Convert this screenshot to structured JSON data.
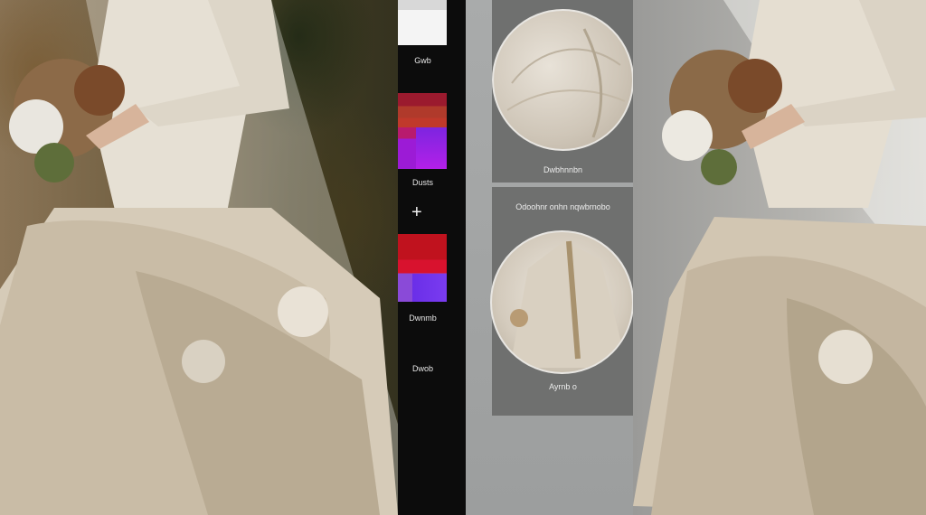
{
  "swatches": {
    "top_label": "Gwb",
    "group1_label": "Dusts",
    "plus_symbol": "+",
    "group2_label_a": "Dwnmb",
    "group2_label_b": "Dwob"
  },
  "cards": {
    "card1_label": "Dwbhnnbn",
    "card2_header": "Odoohnr onhn nqwbrnobo",
    "card2_label": "Ayrnb o"
  },
  "colors": {
    "accent_white": "#f4f4f4",
    "accent_red": "#c0121e",
    "accent_purple": "#9c1bd6",
    "panel_grey": "#6f706f"
  }
}
